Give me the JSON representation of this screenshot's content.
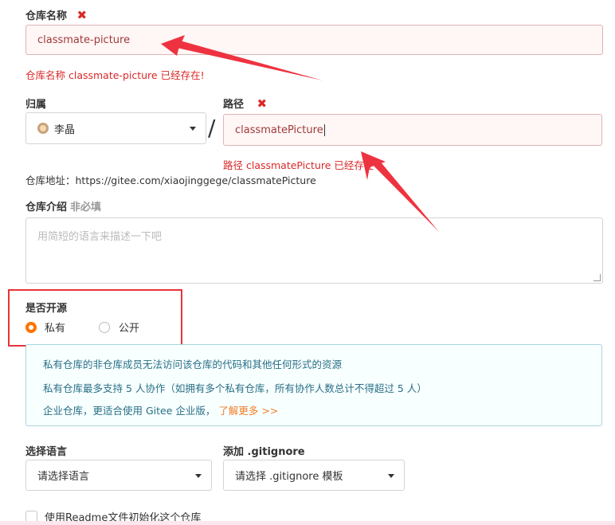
{
  "repo_name": {
    "label": "仓库名称",
    "value": "classmate-picture",
    "error": "仓库名称 classmate-picture 已经存在!"
  },
  "owner": {
    "label": "归属",
    "value": "李晶",
    "separator": "/"
  },
  "path": {
    "label": "路径",
    "value": "classmatePicture",
    "error": "路径 classmatePicture 已经存在"
  },
  "repo_address": "仓库地址：https://gitee.com/xiaojinggege/classmatePicture",
  "description": {
    "label": "仓库介绍",
    "optional": "非必填",
    "placeholder": "用简短的语言来描述一下吧"
  },
  "visibility": {
    "label": "是否开源",
    "options": [
      {
        "label": "私有",
        "selected": true
      },
      {
        "label": "公开",
        "selected": false
      }
    ]
  },
  "info": {
    "line1": "私有仓库的非仓库成员无法访问该仓库的代码和其他任何形式的资源",
    "line2": "私有仓库最多支持 5 人协作（如拥有多个私有仓库，所有协作人数总计不得超过 5 人）",
    "line3": "企业仓库，更适合使用 Gitee 企业版，",
    "link": "了解更多 >>"
  },
  "language": {
    "label": "选择语言",
    "value": "请选择语言"
  },
  "gitignore": {
    "label": "添加 .gitignore",
    "value": "请选择 .gitignore 模板"
  },
  "readme": {
    "label": "使用Readme文件初始化这个仓库"
  },
  "colors": {
    "error": "#db2828",
    "accent": "#fe7300",
    "annotation": "#ee3340"
  }
}
